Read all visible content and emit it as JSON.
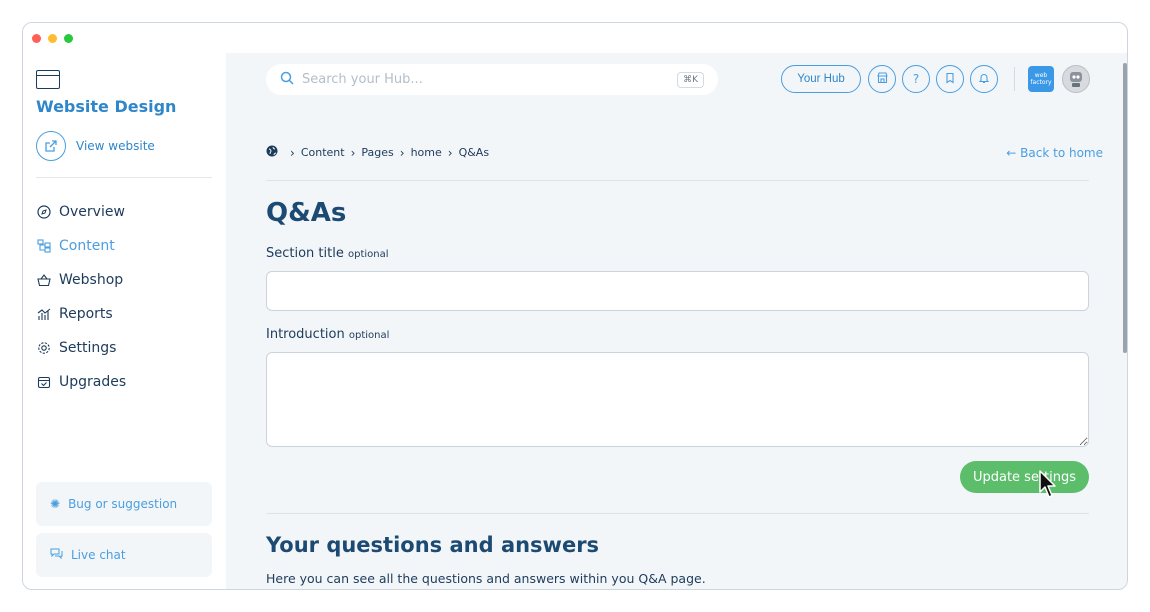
{
  "window": {
    "controls": [
      "close",
      "minimize",
      "maximize"
    ]
  },
  "sidebar": {
    "site_icon": "browser-window-icon",
    "site_title": "Website Design",
    "view_website": "View website",
    "items": [
      {
        "label": "Overview",
        "icon": "compass-icon",
        "active": false
      },
      {
        "label": "Content",
        "icon": "sitemap-icon",
        "active": true
      },
      {
        "label": "Webshop",
        "icon": "basket-icon",
        "active": false
      },
      {
        "label": "Reports",
        "icon": "chart-icon",
        "active": false
      },
      {
        "label": "Settings",
        "icon": "gear-icon",
        "active": false
      },
      {
        "label": "Upgrades",
        "icon": "calendar-check-icon",
        "active": false
      }
    ],
    "bug_label": "Bug or suggestion",
    "chat_label": "Live chat"
  },
  "header": {
    "search_placeholder": "Search your Hub...",
    "search_shortcut": "⌘K",
    "hub_button": "Your Hub",
    "logo_text": "web factory"
  },
  "breadcrumb": {
    "items": [
      "Content",
      "Pages",
      "home",
      "Q&As"
    ],
    "back_link": "← Back to home"
  },
  "form": {
    "page_title": "Q&As",
    "section_title_label": "Section title",
    "section_title_optional": "optional",
    "section_title_value": "",
    "intro_label": "Introduction",
    "intro_optional": "optional",
    "intro_value": "",
    "update_button": "Update settings"
  },
  "questions": {
    "title": "Your questions and answers",
    "description": "Here you can see all the questions and answers within you Q&A page."
  },
  "colors": {
    "accent_blue": "#4a9ee0",
    "dark_blue": "#1d4a72",
    "green": "#5cbe6b",
    "background": "#f3f6f9"
  }
}
